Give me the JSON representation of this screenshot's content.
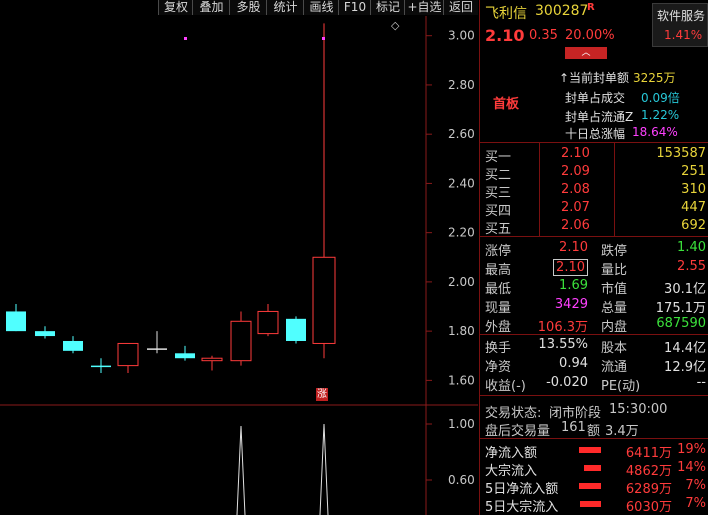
{
  "toolbar": {
    "buttons": [
      "复权",
      "叠加",
      "多股",
      "统计",
      "画线",
      "F10",
      "标记",
      "+自选",
      "返回"
    ]
  },
  "chart": {
    "y_ticks": [
      "3.00",
      "2.80",
      "2.60",
      "2.40",
      "2.20",
      "2.00",
      "1.80",
      "1.60"
    ],
    "vol_ticks": [
      "1.00",
      "0.60"
    ],
    "limit_up_marker": "涨",
    "diamond": "◇"
  },
  "chart_data": {
    "type": "candlestick",
    "ylim": [
      1.5,
      3.08
    ],
    "candles": [
      {
        "open": 1.8,
        "close": 1.88,
        "high": 1.91,
        "low": 1.8,
        "color": "cyan"
      },
      {
        "open": 1.8,
        "close": 1.78,
        "high": 1.82,
        "low": 1.77,
        "color": "cyan"
      },
      {
        "open": 1.76,
        "close": 1.72,
        "high": 1.78,
        "low": 1.71,
        "color": "cyan"
      },
      {
        "open": 1.66,
        "close": 1.66,
        "high": 1.69,
        "low": 1.63,
        "color": "cyan"
      },
      {
        "open": 1.66,
        "close": 1.75,
        "high": 1.75,
        "low": 1.63,
        "color": "red"
      },
      {
        "open": 1.73,
        "close": 1.73,
        "high": 1.8,
        "low": 1.71,
        "color": "white"
      },
      {
        "open": 1.71,
        "close": 1.69,
        "high": 1.74,
        "low": 1.68,
        "color": "cyan"
      },
      {
        "open": 1.69,
        "close": 1.68,
        "high": 1.7,
        "low": 1.64,
        "color": "red"
      },
      {
        "open": 1.68,
        "close": 1.84,
        "high": 1.88,
        "low": 1.66,
        "color": "red"
      },
      {
        "open": 1.79,
        "close": 1.88,
        "high": 1.91,
        "low": 1.78,
        "color": "red"
      },
      {
        "open": 1.85,
        "close": 1.76,
        "high": 1.86,
        "low": 1.75,
        "color": "cyan"
      },
      {
        "open": 1.75,
        "close": 2.1,
        "high": 3.05,
        "low": 1.69,
        "color": "red"
      }
    ]
  },
  "header": {
    "name": "飞利信",
    "code": "300287",
    "badge": "R",
    "price": "2.10",
    "change": "0.35",
    "pct": "20.00%",
    "service_label": "软件服务",
    "service_pct": "1.41%",
    "dropdown": "︿"
  },
  "board": {
    "title": "首板",
    "rows": [
      {
        "label": "↑当前封单额",
        "value": "3225万"
      },
      {
        "label": "封单占成交",
        "value": "0.09倍"
      },
      {
        "label": "封单占流通Z",
        "value": "1.22%"
      },
      {
        "label": "十日总涨幅",
        "value": "18.64%"
      }
    ]
  },
  "bids": [
    {
      "label": "买一",
      "price": "2.10",
      "vol": "153587"
    },
    {
      "label": "买二",
      "price": "2.09",
      "vol": "251"
    },
    {
      "label": "买三",
      "price": "2.08",
      "vol": "310"
    },
    {
      "label": "买四",
      "price": "2.07",
      "vol": "447"
    },
    {
      "label": "买五",
      "price": "2.06",
      "vol": "692"
    }
  ],
  "quote": {
    "rows": [
      {
        "l1": "涨停",
        "v1": "2.10",
        "l2": "跌停",
        "v2": "1.40"
      },
      {
        "l1": "最高",
        "v1": "2.10",
        "l2": "量比",
        "v2": "2.55"
      },
      {
        "l1": "最低",
        "v1": "1.69",
        "l2": "市值",
        "v2": "30.1亿"
      },
      {
        "l1": "现量",
        "v1": "3429",
        "l2": "总量",
        "v2": "175.1万"
      },
      {
        "l1": "外盘",
        "v1": "106.3万",
        "l2": "内盘",
        "v2": "687590"
      }
    ]
  },
  "fin": {
    "rows": [
      {
        "l1": "换手",
        "v1": "13.55%",
        "l2": "股本",
        "v2": "14.4亿"
      },
      {
        "l1": "净资",
        "v1": "0.94",
        "l2": "流通",
        "v2": "12.9亿"
      },
      {
        "l1": "收益(-)",
        "v1": "-0.020",
        "l2": "PE(动)",
        "v2": "--"
      }
    ]
  },
  "status": {
    "state_label": "交易状态:",
    "state_value": "闭市阶段",
    "time": "15:30:00",
    "after_label": "盘后交易量",
    "after_vol": "161",
    "amount_label": "额",
    "amount_value": "3.4万"
  },
  "flows": [
    {
      "label": "净流入额",
      "value": "6411万",
      "pct": "19%",
      "bar": 1.0
    },
    {
      "label": "大宗流入",
      "value": "4862万",
      "pct": "14%",
      "bar": 0.76
    },
    {
      "label": "5日净流入额",
      "value": "6289万",
      "pct": "7%",
      "bar": 0.98
    },
    {
      "label": "5日大宗流入",
      "value": "6030万",
      "pct": "7%",
      "bar": 0.94
    }
  ]
}
